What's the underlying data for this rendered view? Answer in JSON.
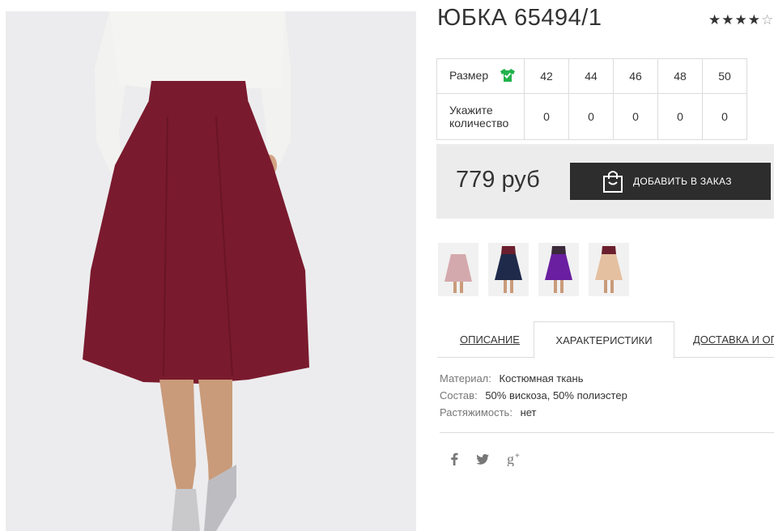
{
  "product": {
    "title": "ЮБКА 65494/1",
    "rating": {
      "stars": "★★★★",
      "empty_star": "☆",
      "value": 4,
      "max": 5
    }
  },
  "sizes": {
    "label": "Размер",
    "qty_label_line1": "Укажите",
    "qty_label_line2": "количество",
    "items": [
      {
        "size": "42",
        "qty": "0"
      },
      {
        "size": "44",
        "qty": "0"
      },
      {
        "size": "46",
        "qty": "0"
      },
      {
        "size": "48",
        "qty": "0"
      },
      {
        "size": "50",
        "qty": "0"
      }
    ],
    "icon": "tshirt-check-icon"
  },
  "purchase": {
    "price": "779 руб",
    "add_button": "ДОБАВИТЬ В ЗАКАЗ",
    "icon": "shopping-bag-icon"
  },
  "thumbnails": [
    {
      "name": "pink",
      "color": "#d4a9ad"
    },
    {
      "name": "navy",
      "color": "#1f2a4a"
    },
    {
      "name": "purple",
      "color": "#6a1fa0"
    },
    {
      "name": "beige",
      "color": "#e4c0a0"
    }
  ],
  "tabs": {
    "description": "ОПИСАНИЕ",
    "characteristics": "ХАРАКТЕРИСТИКИ",
    "delivery": "ДОСТАВКА И ОПЛ"
  },
  "specs": [
    {
      "key": "Материал:",
      "value": "Костюмная ткань"
    },
    {
      "key": "Состав:",
      "value": "50% вискоза, 50% полиэстер"
    },
    {
      "key": "Растяжимость:",
      "value": "нет"
    }
  ],
  "social": {
    "facebook": "f",
    "twitter": "🐦",
    "googleplus": "g+"
  },
  "colors": {
    "skirt": "#7a1a2e",
    "button_bg": "#2d2d2d",
    "price_bg": "#ececec",
    "check_green": "#22b24c"
  }
}
